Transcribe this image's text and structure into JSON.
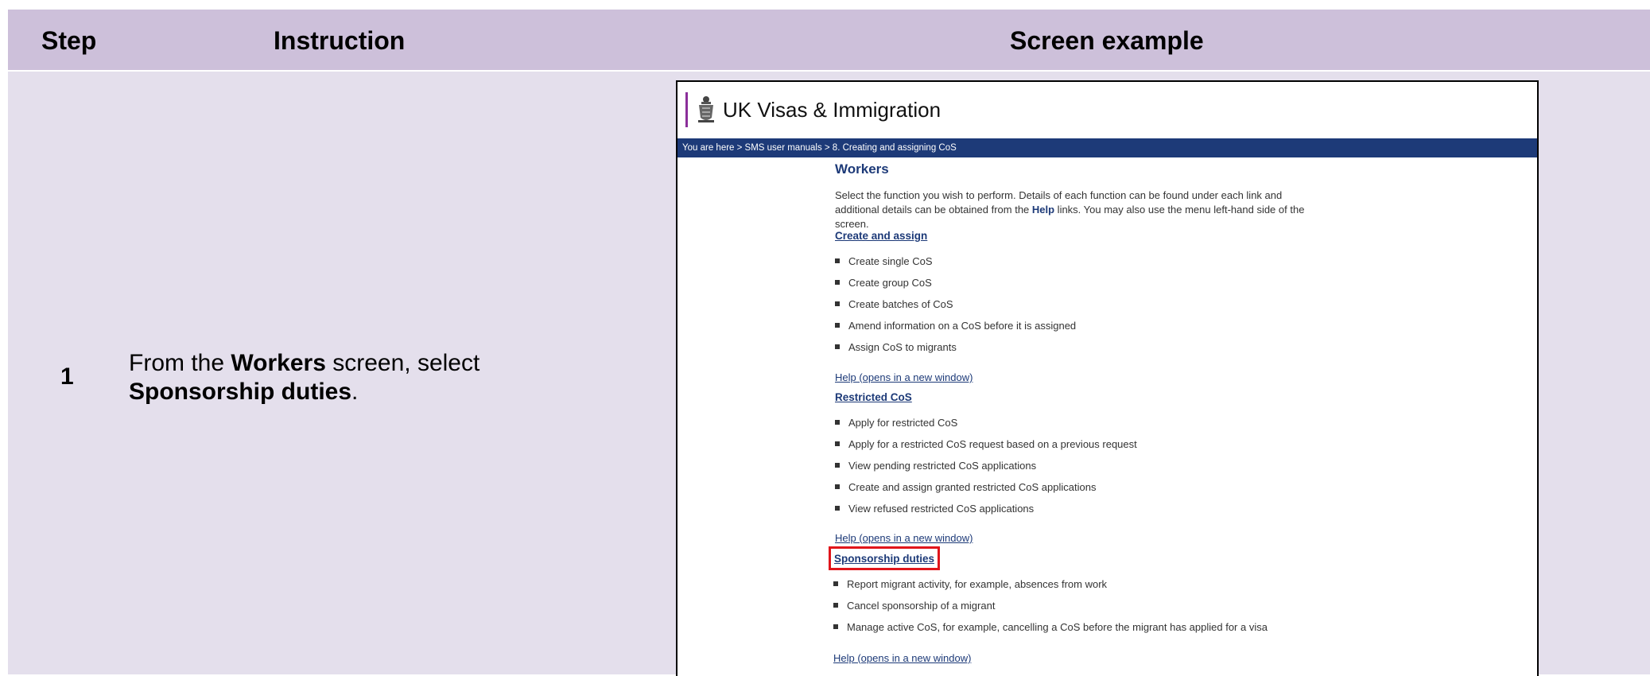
{
  "header": {
    "step": "Step",
    "instruction": "Instruction",
    "screen_example": "Screen example"
  },
  "row": {
    "step_number": "1",
    "instruction_pre": "From the ",
    "instruction_bold1": "Workers",
    "instruction_mid": " screen, select ",
    "instruction_bold2": "Sponsorship duties",
    "instruction_post": "."
  },
  "screen": {
    "brand": "UK Visas & Immigration",
    "breadcrumb": "You are here > SMS user manuals >  8. Creating and assigning CoS",
    "title": "Workers",
    "intro_pre": "Select the function you wish to perform. Details of each function can be found under each link and additional details can be obtained from the ",
    "intro_bold": "Help",
    "intro_post": " links. You may also use the menu left-hand side of the screen.",
    "sections": [
      {
        "title": "Create and assign",
        "items": [
          "Create single CoS",
          "Create group CoS",
          "Create batches of CoS",
          "Amend information on a CoS before it is assigned",
          "Assign CoS to migrants"
        ],
        "help": "Help (opens in a new window)"
      },
      {
        "title": "Restricted CoS",
        "items": [
          "Apply for restricted CoS",
          "Apply for a restricted CoS request based on a previous request",
          "View pending restricted CoS applications",
          "Create and assign granted restricted CoS applications",
          "View refused restricted CoS applications"
        ],
        "help": "Help (opens in a new window)"
      },
      {
        "title": "Sponsorship duties",
        "items": [
          "Report migrant activity, for example, absences from work",
          "Cancel sponsorship of a migrant",
          "Manage active CoS, for example, cancelling a CoS before the migrant has applied for a visa"
        ],
        "help": "Help (opens in a new window)"
      }
    ]
  },
  "colors": {
    "header_bg": "#cdc0da",
    "row_bg": "#e4dfec",
    "nav_bar": "#1d3a78",
    "highlight": "#e0151b",
    "brand_bar": "#8b2f9a"
  }
}
